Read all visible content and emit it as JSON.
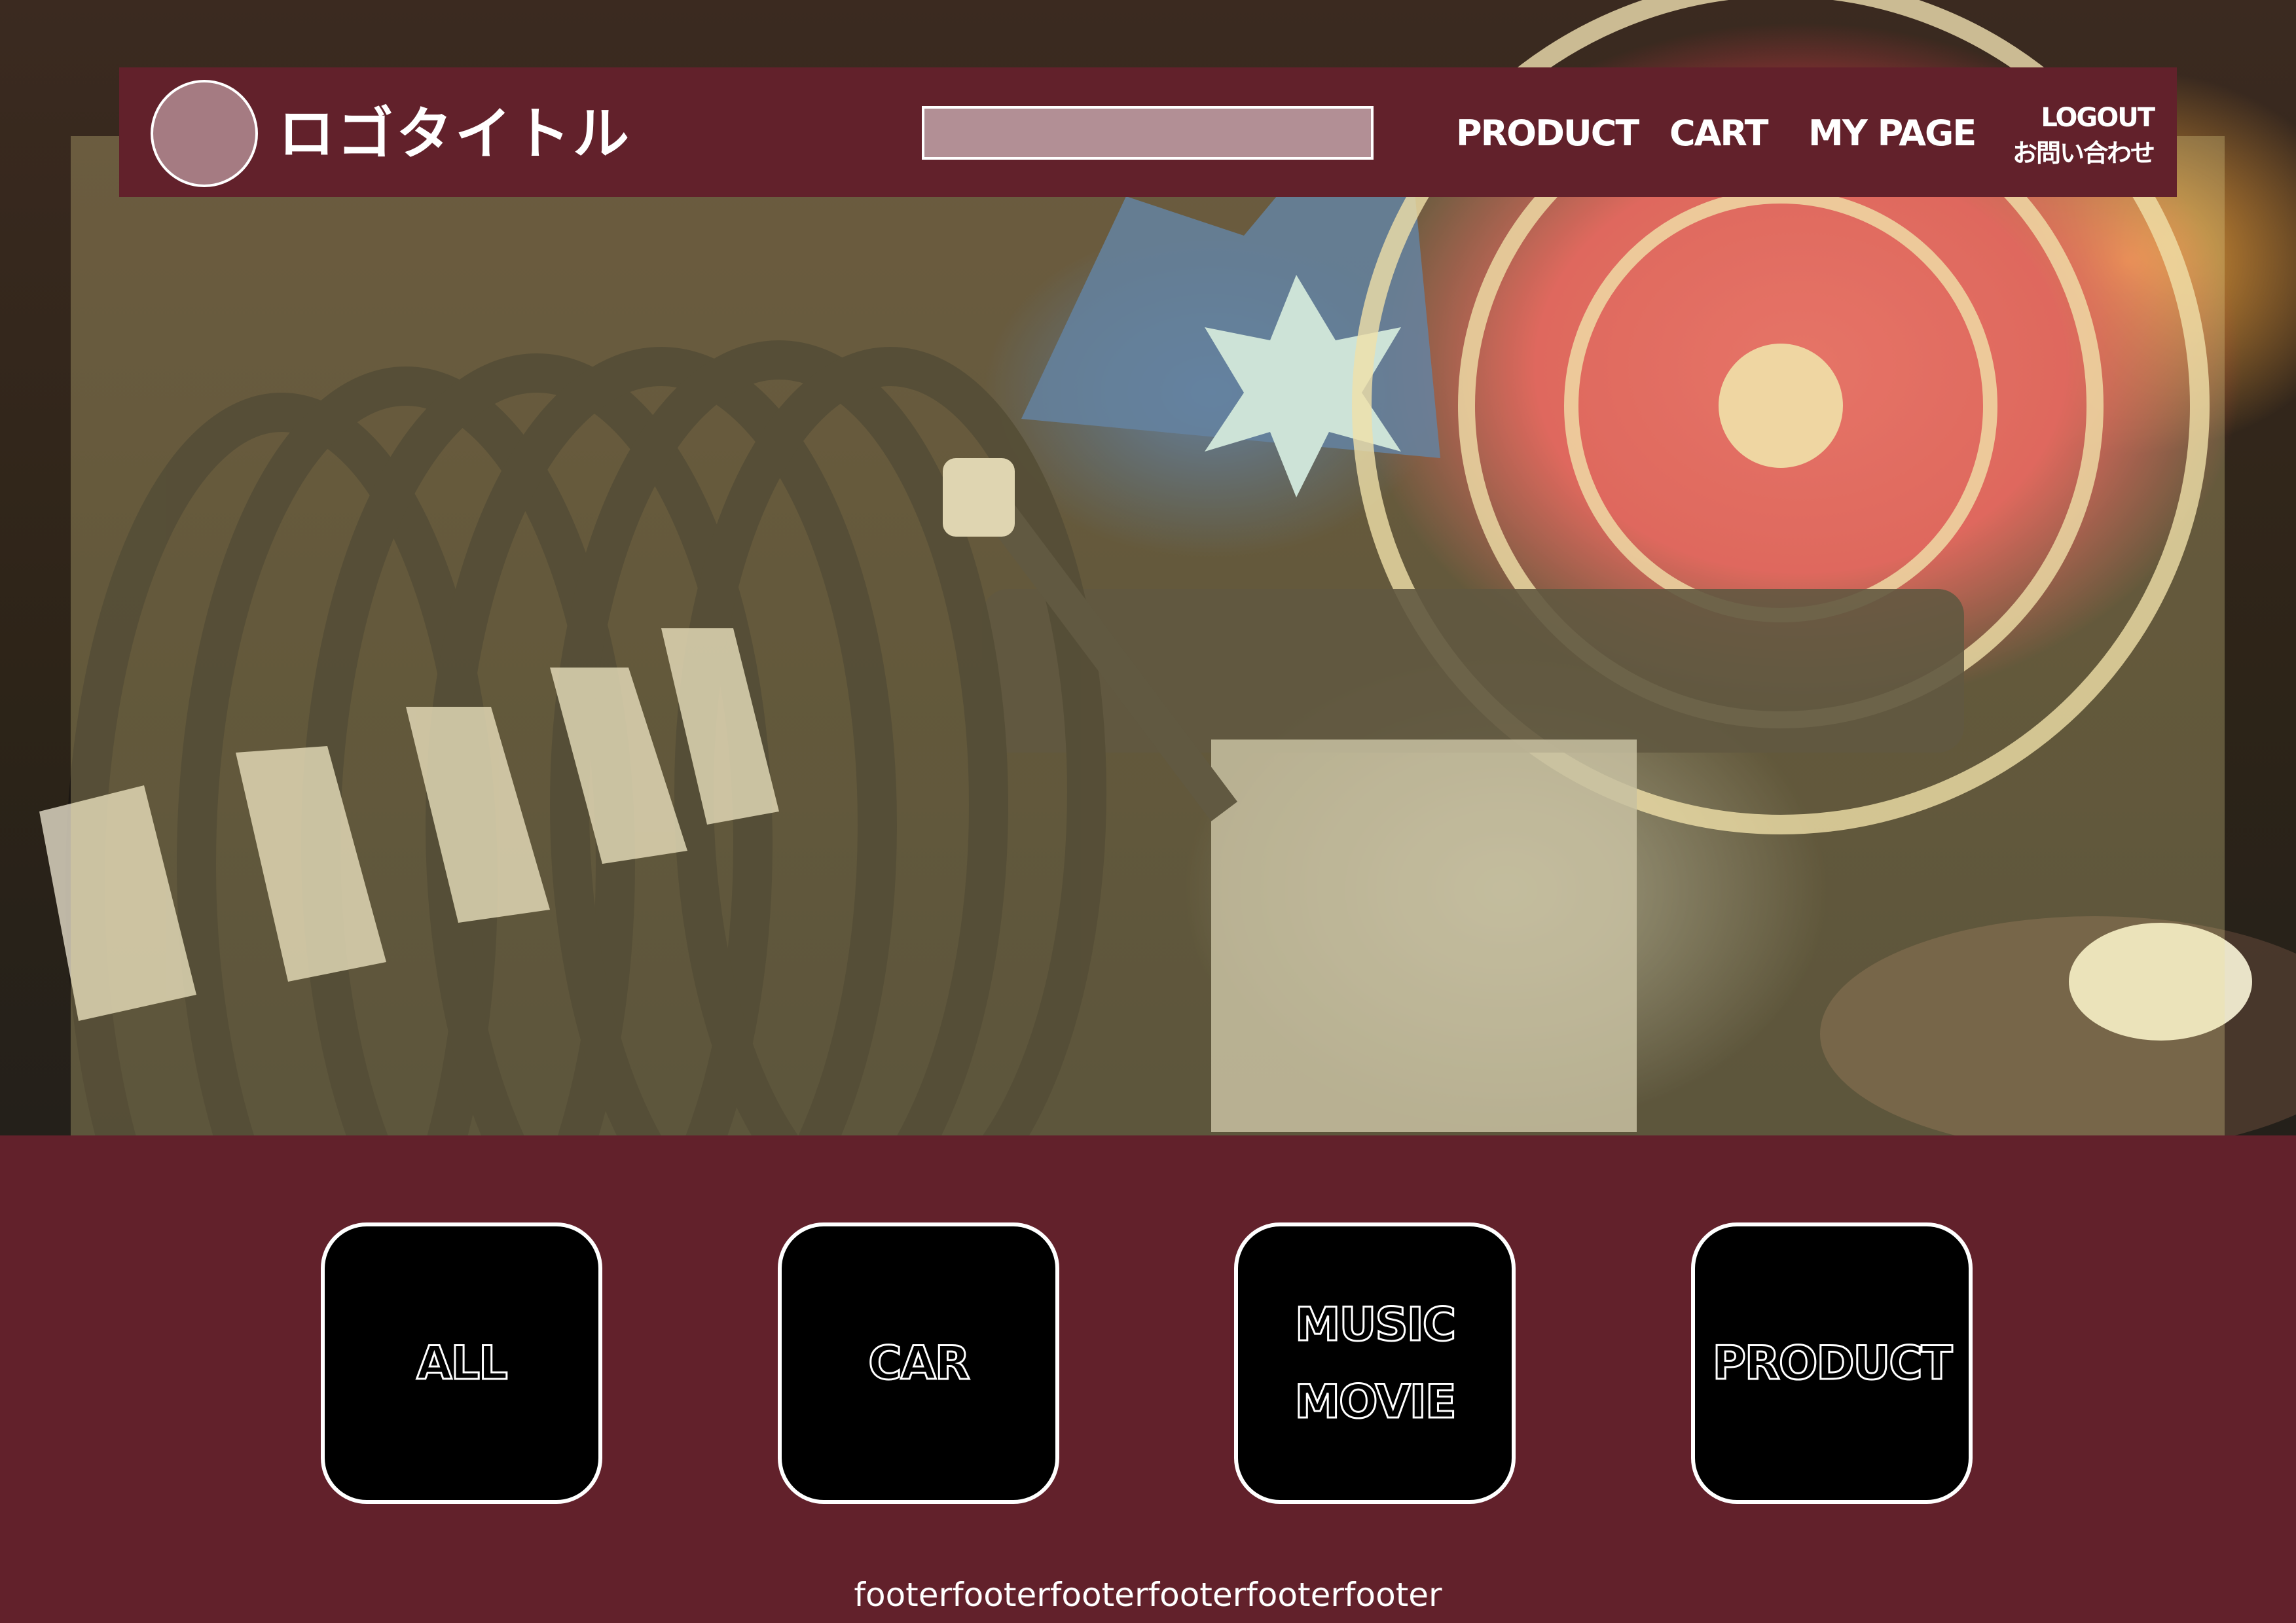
{
  "header": {
    "logo_title": "ロゴタイトル",
    "search": {
      "value": "",
      "placeholder": ""
    },
    "nav": {
      "product": "PRODUCT",
      "cart": "CART",
      "my_page": "MY PAGE",
      "logout": "LOGOUT",
      "contact": "お問い合わせ"
    }
  },
  "categories": [
    {
      "lines": [
        "ALL"
      ]
    },
    {
      "lines": [
        "CAR"
      ]
    },
    {
      "lines": [
        "MUSIC",
        "MOVIE"
      ]
    },
    {
      "lines": [
        "PRODUCT"
      ]
    }
  ],
  "footer": {
    "text": "footerfooterfooterfooterfooterfooter"
  },
  "colors": {
    "brand": "#62212b",
    "logo_circle": "#a57b82",
    "search_fill": "#b28f95",
    "tile": "#000000",
    "text": "#ffffff"
  }
}
